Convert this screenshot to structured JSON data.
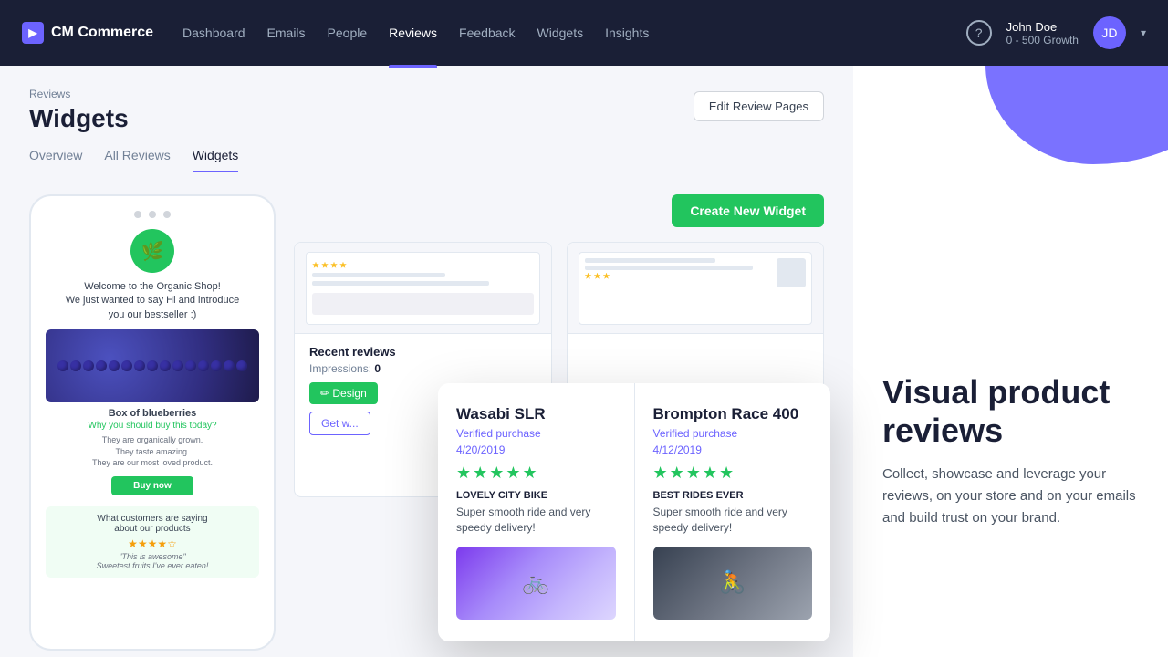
{
  "navbar": {
    "logo": "CM Commerce",
    "logo_icon": "▶",
    "links": [
      {
        "label": "Dashboard",
        "active": false
      },
      {
        "label": "Emails",
        "active": false
      },
      {
        "label": "People",
        "active": false
      },
      {
        "label": "Reviews",
        "active": true
      },
      {
        "label": "Feedback",
        "active": false
      },
      {
        "label": "Widgets",
        "active": false
      },
      {
        "label": "Insights",
        "active": false
      }
    ],
    "help_label": "?",
    "user_name": "John Doe",
    "user_plan": "0 - 500 Growth",
    "user_initials": "JD",
    "dropdown_icon": "▾"
  },
  "header": {
    "breadcrumb": "Reviews",
    "title": "Widgets",
    "edit_review_btn": "Edit Review Pages"
  },
  "tabs": [
    {
      "label": "Overview",
      "active": false
    },
    {
      "label": "All Reviews",
      "active": false
    },
    {
      "label": "Widgets",
      "active": true
    }
  ],
  "create_widget_btn": "Create New Widget",
  "phone": {
    "welcome_text": "Welcome to the Organic Shop!\nWe just wanted to say Hi and introduce you our bestseller :)",
    "product_name": "Box of blueberries",
    "product_reason": "Why you should buy this today?",
    "product_desc1": "They are organically grown.",
    "product_desc2": "They taste amazing.",
    "product_desc3": "They are our most loved product.",
    "buy_btn": "Buy now",
    "reviews_heading1": "What customers are saying",
    "reviews_heading2": "about our products",
    "stars": "★★★★☆",
    "review_quote": "\"This is awesome\"",
    "review_sub": "Sweetest fruits I've ever eaten!"
  },
  "widget_cards": [
    {
      "title": "Recent reviews",
      "impressions_label": "Impressions:",
      "impressions_count": "0",
      "design_btn": "✏ Design",
      "get_widget_btn": "Get w..."
    },
    {
      "title": "",
      "impressions_label": "",
      "impressions_count": "",
      "design_btn": "",
      "get_widget_btn": ""
    }
  ],
  "popup": {
    "cards": [
      {
        "product": "Wasabi SLR",
        "verified": "Verified purchase",
        "date": "4/20/2019",
        "stars": "★★★★★",
        "review_title": "LOVELY CITY BIKE",
        "review_text": "Super smooth ride and very speedy delivery!"
      },
      {
        "product": "Brompton Race 400",
        "verified": "Verified purchase",
        "date": "4/12/2019",
        "stars": "★★★★★",
        "review_title": "BEST RIDES EVER",
        "review_text": "Super smooth ride and very speedy delivery!"
      }
    ]
  },
  "branding": {
    "title": "Visual product reviews",
    "description": "Collect, showcase and leverage your reviews, on your store and on your emails and build trust on your brand."
  }
}
